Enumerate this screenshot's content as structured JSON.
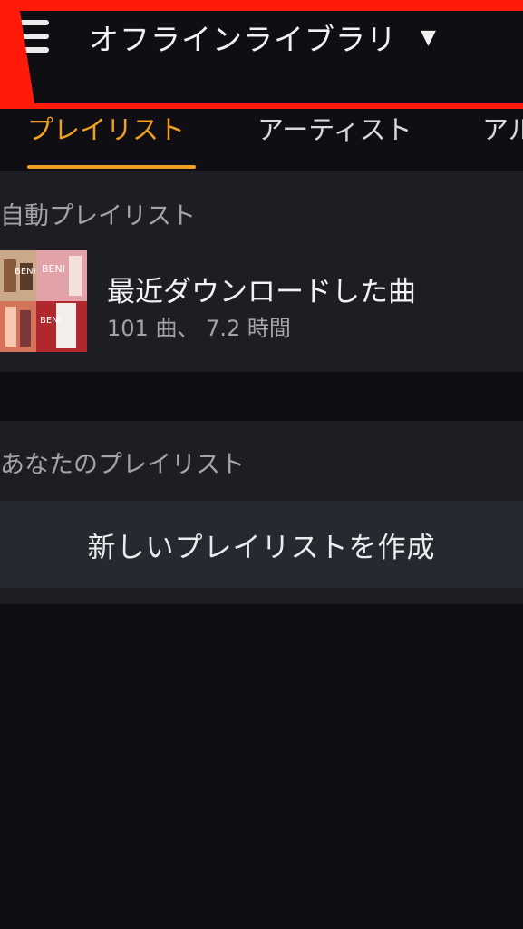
{
  "header": {
    "menu_icon": "hamburger-menu-icon",
    "title": "オフラインライブラリ",
    "caret": "▼"
  },
  "tabs": [
    {
      "label": "プレイリスト",
      "active": true
    },
    {
      "label": "アーティスト",
      "active": false
    },
    {
      "label": "アル",
      "active": false
    }
  ],
  "auto_playlists": {
    "section_title": "自動プレイリスト",
    "items": [
      {
        "title": "最近ダウンロードした曲",
        "subtitle": "101 曲、 7.2 時間"
      }
    ]
  },
  "your_playlists": {
    "section_title": "あなたのプレイリスト",
    "create_label": "新しいプレイリストを作成"
  },
  "colors": {
    "accent": "#f0a020",
    "highlight_box": "#ff1a0a",
    "background": "#0f0f13",
    "panel": "#1c1e23"
  }
}
